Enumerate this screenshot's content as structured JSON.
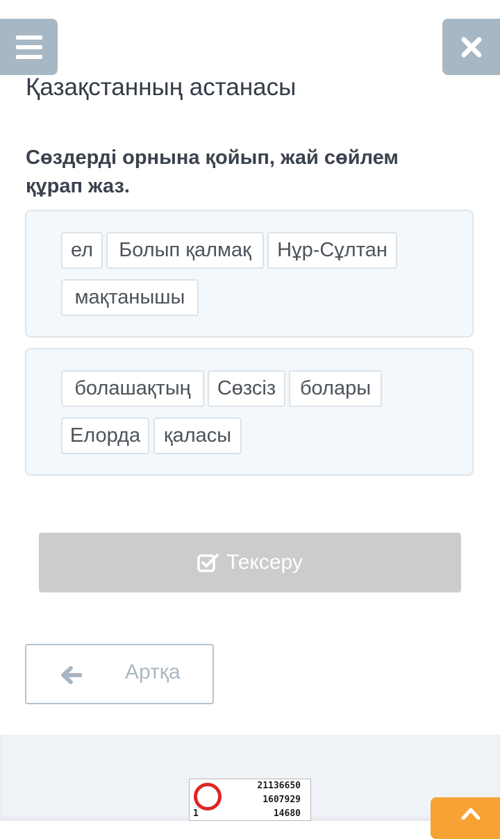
{
  "header": {
    "menu_icon": "hamburger-menu-icon",
    "close_icon": "close-x-icon",
    "title": "Қазақстанның астанасы"
  },
  "task": {
    "instruction": "Сөздерді орнына қойып, жай сөйлем құрап жаз."
  },
  "groups": [
    {
      "words": [
        "ел",
        "Болып қалмақ",
        "Нұр-Сұлтан",
        "мақтанышы"
      ]
    },
    {
      "words": [
        "болашақтың",
        "Сөзсіз",
        "болары",
        "Елорда",
        "қаласы"
      ]
    }
  ],
  "actions": {
    "check_label": "Тексеру",
    "check_icon": "checkbox-check-icon",
    "back_label": "Артқа",
    "back_icon": "arrow-left-icon"
  },
  "stamp": {
    "line1": "21136650",
    "line2": "1607929",
    "line3": "14680",
    "corner": "1"
  },
  "colors": {
    "accent_grey_blue": "#a7b7c3",
    "disabled_button": "#cccccc",
    "orange": "#f7a234"
  }
}
